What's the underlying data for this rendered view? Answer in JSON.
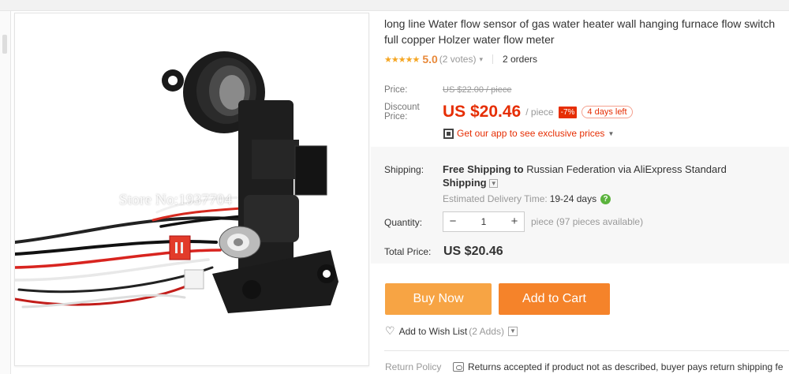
{
  "product": {
    "title": "long line Water flow sensor of gas water heater wall hanging furnace flow switch full copper Holzer water flow meter",
    "watermark": "Store No:1937704",
    "rating": {
      "stars": "★★★★★",
      "score": "5.0",
      "votes": "(2 votes)",
      "orders": "2 orders"
    }
  },
  "price": {
    "label": "Price:",
    "original": "US $22.00 / piece",
    "discount_label_1": "Discount",
    "discount_label_2": "Price:",
    "current": "US $20.46",
    "per_unit": "/ piece",
    "discount_pct": "-7%",
    "days_left": "4 days left",
    "app_promo": "Get our app to see exclusive prices"
  },
  "shipping": {
    "label": "Shipping:",
    "free_text": "Free Shipping to",
    "rest_text": "Russian Federation via AliExpress Standard",
    "method": "Shipping",
    "est_label": "Estimated Delivery Time:",
    "est_value": "19-24 days"
  },
  "quantity": {
    "label": "Quantity:",
    "value": "1",
    "minus": "−",
    "plus": "+",
    "available": "piece (97 pieces available)"
  },
  "total": {
    "label": "Total Price:",
    "value": "US $20.46"
  },
  "actions": {
    "buy_now": "Buy Now",
    "add_to_cart": "Add to Cart"
  },
  "wishlist": {
    "label": "Add to Wish List",
    "count": "(2 Adds)"
  },
  "return_policy": {
    "label": "Return Policy",
    "text": "Returns accepted if product not as described, buyer pays return shipping fe"
  },
  "colors": {
    "accent_red": "#e62e04",
    "button_orange": "#f5832a",
    "button_light_orange": "#f7a444",
    "star": "#f5a623"
  }
}
